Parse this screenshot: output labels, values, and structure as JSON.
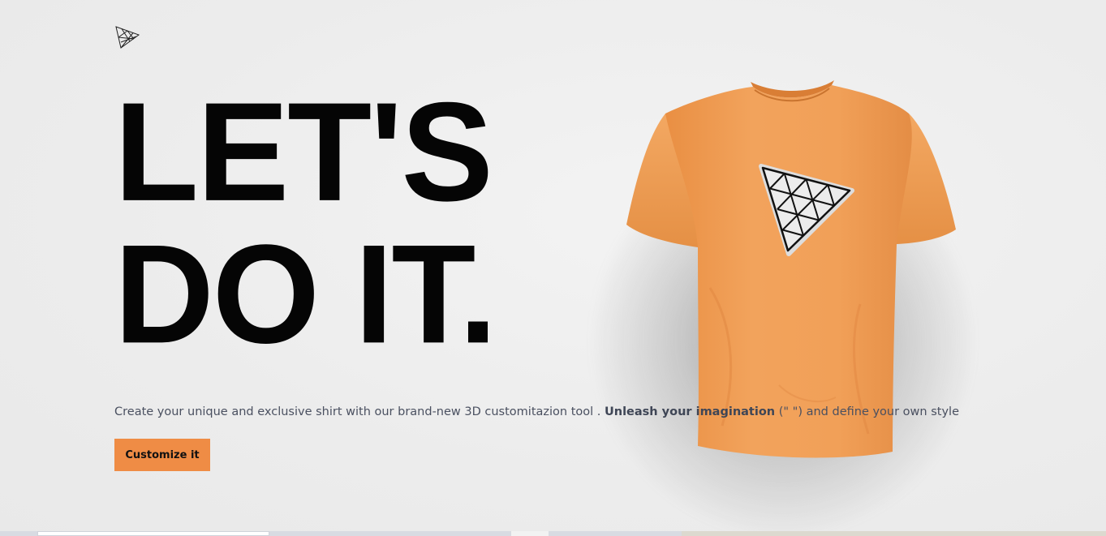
{
  "header": {
    "logo_icon": "triangle-grid-logo-icon"
  },
  "hero": {
    "headline_line1": "LET'S",
    "headline_line2": "DO IT.",
    "tagline_part1": "Create your unique and exclusive shirt with our brand-new 3D customitazion tool . ",
    "tagline_bold": "Unleash your imagination",
    "tagline_part2": " (\" \") and define your own style",
    "cta_label": "Customize it"
  },
  "product": {
    "shirt_color": "#f0a25a",
    "decal_icon": "triangle-grid-decal-icon"
  },
  "colors": {
    "accent": "#ef8c45",
    "background": "#efefef",
    "text_dark": "#050505"
  }
}
